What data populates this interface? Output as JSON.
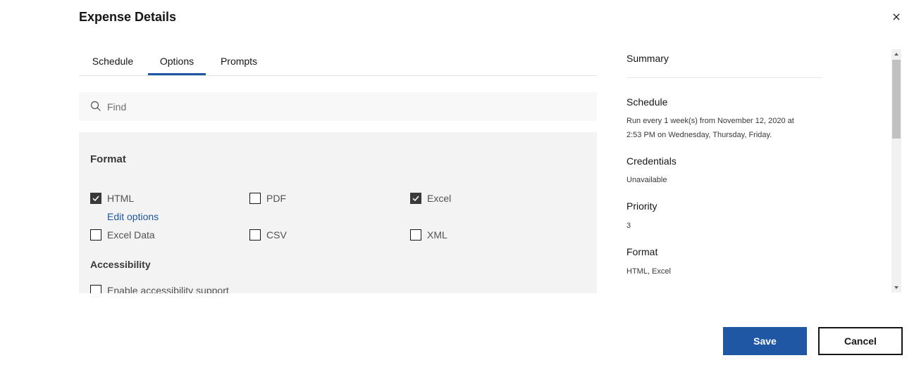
{
  "dialog": {
    "title": "Expense Details"
  },
  "tabs": [
    {
      "label": "Schedule",
      "active": false
    },
    {
      "label": "Options",
      "active": true
    },
    {
      "label": "Prompts",
      "active": false
    }
  ],
  "find": {
    "placeholder": "Find"
  },
  "format_section": {
    "title": "Format",
    "options": [
      {
        "label": "HTML",
        "checked": true
      },
      {
        "label": "PDF",
        "checked": false
      },
      {
        "label": "Excel",
        "checked": true
      },
      {
        "label": "Excel Data",
        "checked": false
      },
      {
        "label": "CSV",
        "checked": false
      },
      {
        "label": "XML",
        "checked": false
      }
    ],
    "edit_options_link": "Edit options"
  },
  "accessibility_section": {
    "title": "Accessibility",
    "option": {
      "label": "Enable accessibility support",
      "checked": false
    }
  },
  "summary": {
    "heading": "Summary",
    "schedule_label": "Schedule",
    "schedule_line1": "Run every 1 week(s) from November 12, 2020 at",
    "schedule_line2": "2:53 PM on Wednesday, Thursday, Friday.",
    "credentials_label": "Credentials",
    "credentials_value": "Unavailable",
    "priority_label": "Priority",
    "priority_value": "3",
    "format_label": "Format",
    "format_value": "HTML, Excel"
  },
  "actions": {
    "save_label": "Save",
    "cancel_label": "Cancel"
  },
  "colors": {
    "accent": "#1f57a4",
    "panel_bg": "#f3f3f3",
    "checkbox_checked": "#3a3a3a"
  },
  "icons": {
    "close": "close-icon",
    "search": "search-icon",
    "checkmark": "checkmark-icon",
    "scroll_up": "caret-up-icon",
    "scroll_down": "caret-down-icon"
  }
}
